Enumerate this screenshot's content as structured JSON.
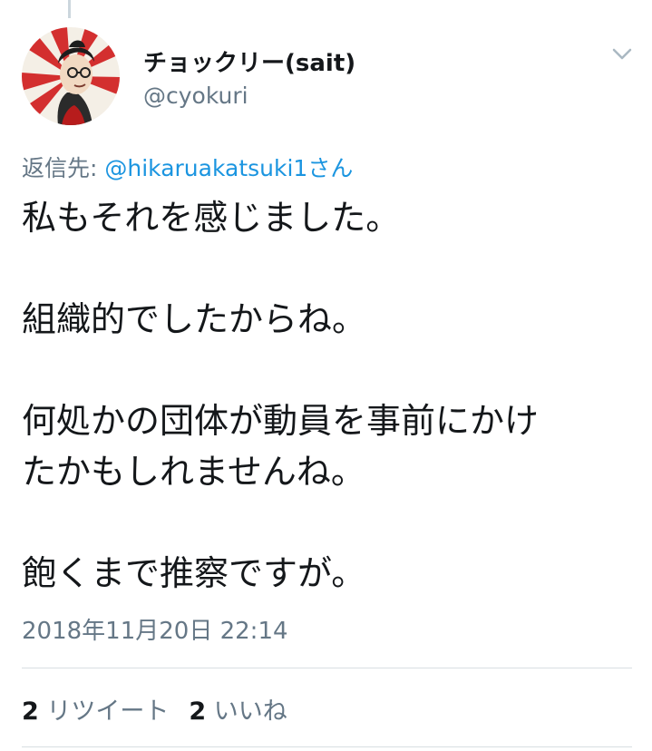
{
  "tweet": {
    "display_name": "チョックリー(sait)",
    "handle": "@cyokuri",
    "reply_prefix": "返信先: ",
    "reply_to": "@hikaruakatsuki1さん",
    "lines": [
      "私もそれを感じました。",
      "",
      "組織的でしたからね。",
      "",
      "何処かの団体が動員を事前にかけ",
      "たかもしれませんね。",
      "",
      "飽くまで推察ですが。"
    ],
    "timestamp": "2018年11月20日 22:14",
    "retweet_count": "2",
    "retweet_label": "リツイート",
    "like_count": "2",
    "like_label": "いいね"
  },
  "icons": {
    "avatar": "ukiyoe-portrait-avatar",
    "menu": "chevron-down-icon"
  },
  "colors": {
    "link": "#1b95e0",
    "secondary_text": "#657786",
    "primary_text": "#14171a",
    "avatar_sun": "#d32f2f"
  }
}
